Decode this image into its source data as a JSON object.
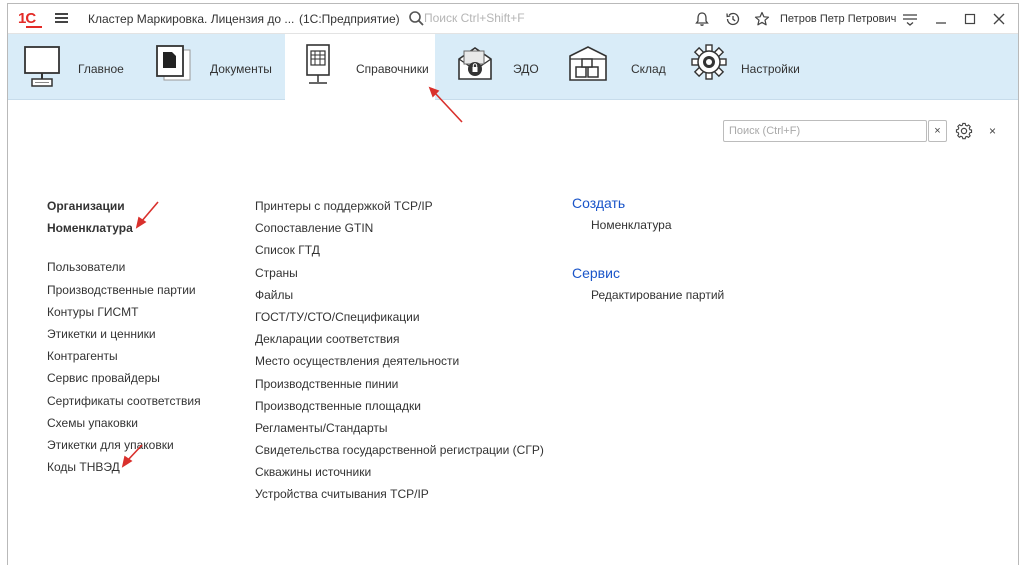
{
  "titlebar": {
    "logo": "1С",
    "title": "Кластер Маркировка. Лицензия до ...",
    "app": "(1С:Предприятие)",
    "search_placeholder": "Поиск Ctrl+Shift+F",
    "user": "Петров Петр Петрович"
  },
  "sections": [
    {
      "label": "Главное",
      "icon": "monitor-icon"
    },
    {
      "label": "Документы",
      "icon": "documents-icon"
    },
    {
      "label": "Справочники",
      "icon": "catalog-icon",
      "active": true
    },
    {
      "label": "ЭДО",
      "icon": "edo-icon"
    },
    {
      "label": "Склад",
      "icon": "warehouse-icon"
    },
    {
      "label": "Настройки",
      "icon": "settings-gear-icon"
    }
  ],
  "content": {
    "search_placeholder": "Поиск (Ctrl+F)",
    "clear_label": "×",
    "close_label": "×",
    "column1_top": [
      "Организации",
      "Номенклатура"
    ],
    "column1": [
      "Пользователи",
      "Производственные партии",
      "Контуры ГИСМТ",
      "Этикетки и ценники",
      "Контрагенты",
      "Сервис провайдеры",
      "Сертификаты соответствия",
      "Схемы упаковки",
      "Этикетки для упаковки",
      "Коды ТНВЭД"
    ],
    "column2": [
      "Принтеры с поддержкой TCP/IP",
      "Сопоставление GTIN",
      "Список ГТД",
      "Страны",
      "Файлы",
      "ГОСТ/ТУ/СТО/Спецификации",
      "Декларации соответствия",
      "Место осуществления деятельности",
      "Производственные пинии",
      "Производственные площадки",
      "Регламенты/Стандарты",
      "Свидетельства государственной регистрации (СГР)",
      "Скважины источники",
      "Устройства считывания TCP/IP"
    ],
    "groups": [
      {
        "title": "Создать",
        "items": [
          "Номенклатура"
        ]
      },
      {
        "title": "Сервис",
        "items": [
          "Редактирование партий"
        ]
      }
    ]
  },
  "colors": {
    "section_bg": "#d9ecf8",
    "link_blue": "#1a55c9",
    "logo_red": "#e32b27",
    "annotation_red": "#d9302c"
  }
}
